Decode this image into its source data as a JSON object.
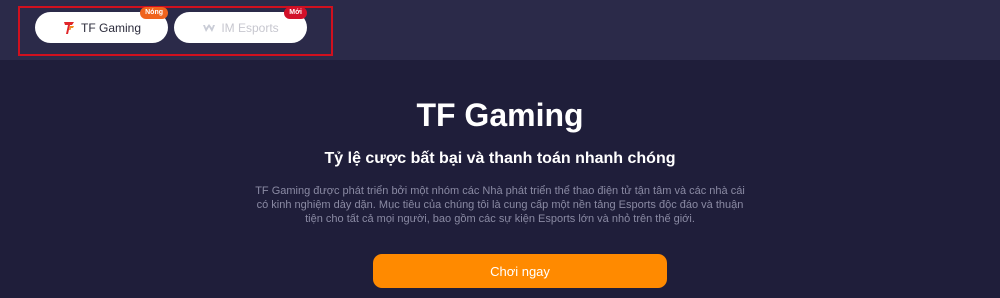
{
  "tabs": [
    {
      "label": "TF Gaming",
      "badge": "Nóng",
      "icon": "tf-gaming-logo-icon",
      "active": true
    },
    {
      "label": "IM Esports",
      "badge": "Mới",
      "icon": "im-esports-logo-icon",
      "active": false
    }
  ],
  "colors": {
    "background": "#1f1e3a",
    "topbar": "#2b2a49",
    "highlight_frame": "#d0101e",
    "hot_badge": "#f0641e",
    "new_badge": "#d2102a",
    "cta": "#ff8a00"
  },
  "hero": {
    "title": "TF Gaming",
    "subtitle": "Tỷ lệ cược bất bại và thanh toán nhanh chóng",
    "description": "TF Gaming được phát triển bởi một nhóm các Nhà phát triển thể thao điện tử tận tâm và các nhà cái có kinh nghiệm dày dặn. Mục tiêu của chúng tôi là cung cấp một nền tảng Esports độc đáo và thuận tiện cho tất cả mọi người, bao gồm các sự kiện Esports lớn và nhỏ trên thế giới.",
    "cta_label": "Chơi ngay"
  }
}
